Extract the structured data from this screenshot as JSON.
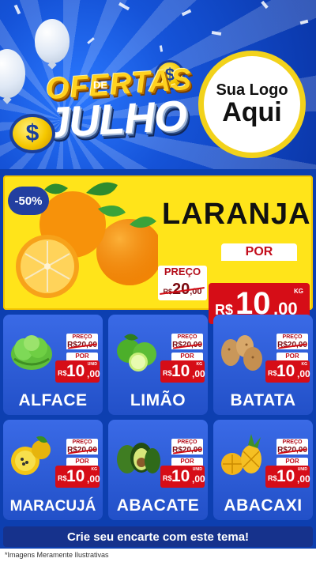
{
  "header": {
    "title_top": "OFERTAS",
    "title_mid": "DE",
    "title_bottom": "JULHO",
    "coin_symbol": "$",
    "logo_line1": "Sua Logo",
    "logo_line2": "Aqui"
  },
  "featured": {
    "discount": "-50%",
    "name": "LARANJA",
    "preco_label": "PREÇO",
    "old_price_currency": "R$",
    "old_price": "20",
    "old_price_cents": ",00",
    "por_label": "POR",
    "currency": "R$",
    "price_int": "10",
    "price_cents": ",00",
    "unit": "KG"
  },
  "cards": [
    {
      "name": "ALFACE",
      "preco_label": "PREÇO",
      "old_price": "R$20,00",
      "por_label": "POR",
      "currency": "R$",
      "price_int": "10",
      "price_cents": ",00",
      "unit": "UNID",
      "icon": "lettuce-icon"
    },
    {
      "name": "LIMÃO",
      "preco_label": "PREÇO",
      "old_price": "R$20,00",
      "por_label": "POR",
      "currency": "R$",
      "price_int": "10",
      "price_cents": ",00",
      "unit": "KG",
      "icon": "lime-icon"
    },
    {
      "name": "BATATA",
      "preco_label": "PREÇO",
      "old_price": "R$20,00",
      "por_label": "POR",
      "currency": "R$",
      "price_int": "10",
      "price_cents": ",00",
      "unit": "KG",
      "icon": "potato-icon"
    },
    {
      "name": "MARACUJÁ",
      "preco_label": "PREÇO",
      "old_price": "R$20,00",
      "por_label": "POR",
      "currency": "R$",
      "price_int": "10",
      "price_cents": ",00",
      "unit": "KG",
      "icon": "passion-fruit-icon"
    },
    {
      "name": "ABACATE",
      "preco_label": "PREÇO",
      "old_price": "R$20,00",
      "por_label": "POR",
      "currency": "R$",
      "price_int": "10",
      "price_cents": ",00",
      "unit": "UNID",
      "icon": "avocado-icon"
    },
    {
      "name": "ABACAXI",
      "preco_label": "PREÇO",
      "old_price": "R$20,00",
      "por_label": "POR",
      "currency": "R$",
      "price_int": "10",
      "price_cents": ",00",
      "unit": "UNID",
      "icon": "pineapple-icon"
    }
  ],
  "cta": "Crie seu encarte com este tema!",
  "footer_note": "*Imagens Meramente Ilustrativas",
  "colors": {
    "background_blue": "#0d3fb0",
    "card_blue": "#2a5bd8",
    "featured_yellow": "#ffe41a",
    "price_red": "#d60d17",
    "title_yellow": "#ffd21f"
  }
}
